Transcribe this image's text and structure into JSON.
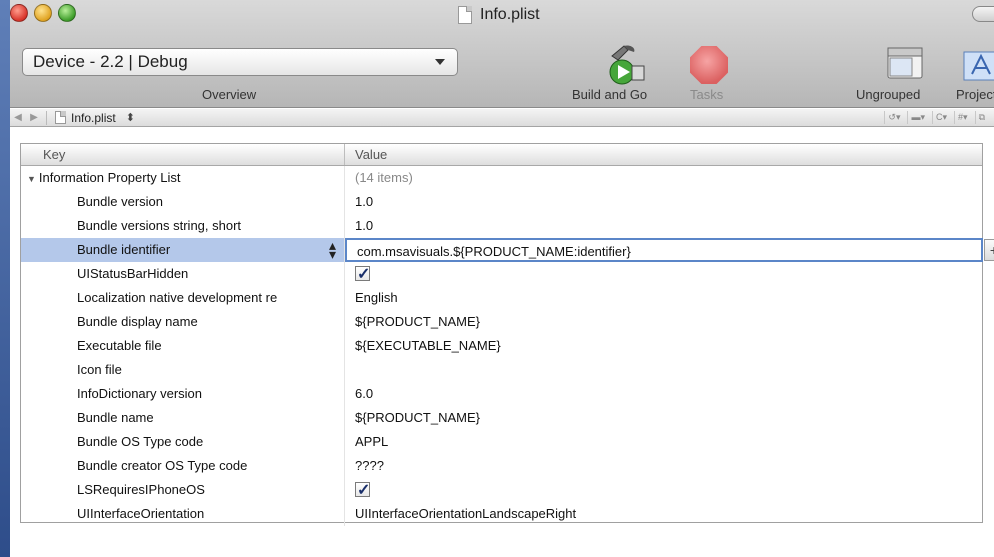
{
  "window": {
    "title": "Info.plist"
  },
  "toolbar": {
    "scheme": "Device - 2.2 | Debug",
    "overview_label": "Overview",
    "build_label": "Build and Go",
    "tasks_label": "Tasks",
    "ungrouped_label": "Ungrouped",
    "project_label": "Project"
  },
  "navbar": {
    "file": "Info.plist",
    "updown": "⬍"
  },
  "table": {
    "header_key": "Key",
    "header_value": "Value",
    "root": {
      "key": "Information Property List",
      "value": "(14 items)"
    },
    "rows": [
      {
        "key": "Bundle version",
        "value": "1.0"
      },
      {
        "key": "Bundle versions string, short",
        "value": "1.0"
      },
      {
        "key": "Bundle identifier",
        "value": "com.msavisuals.${PRODUCT_NAME:identifier}"
      },
      {
        "key": "UIStatusBarHidden",
        "value": ""
      },
      {
        "key": "Localization native development re",
        "value": "English"
      },
      {
        "key": "Bundle display name",
        "value": "${PRODUCT_NAME}"
      },
      {
        "key": "Executable file",
        "value": "${EXECUTABLE_NAME}"
      },
      {
        "key": "Icon file",
        "value": ""
      },
      {
        "key": "InfoDictionary version",
        "value": "6.0"
      },
      {
        "key": "Bundle name",
        "value": "${PRODUCT_NAME}"
      },
      {
        "key": "Bundle OS Type code",
        "value": "APPL"
      },
      {
        "key": "Bundle creator OS Type code",
        "value": "????"
      },
      {
        "key": "LSRequiresIPhoneOS",
        "value": ""
      },
      {
        "key": "UIInterfaceOrientation",
        "value": "UIInterfaceOrientationLandscapeRight"
      }
    ]
  }
}
